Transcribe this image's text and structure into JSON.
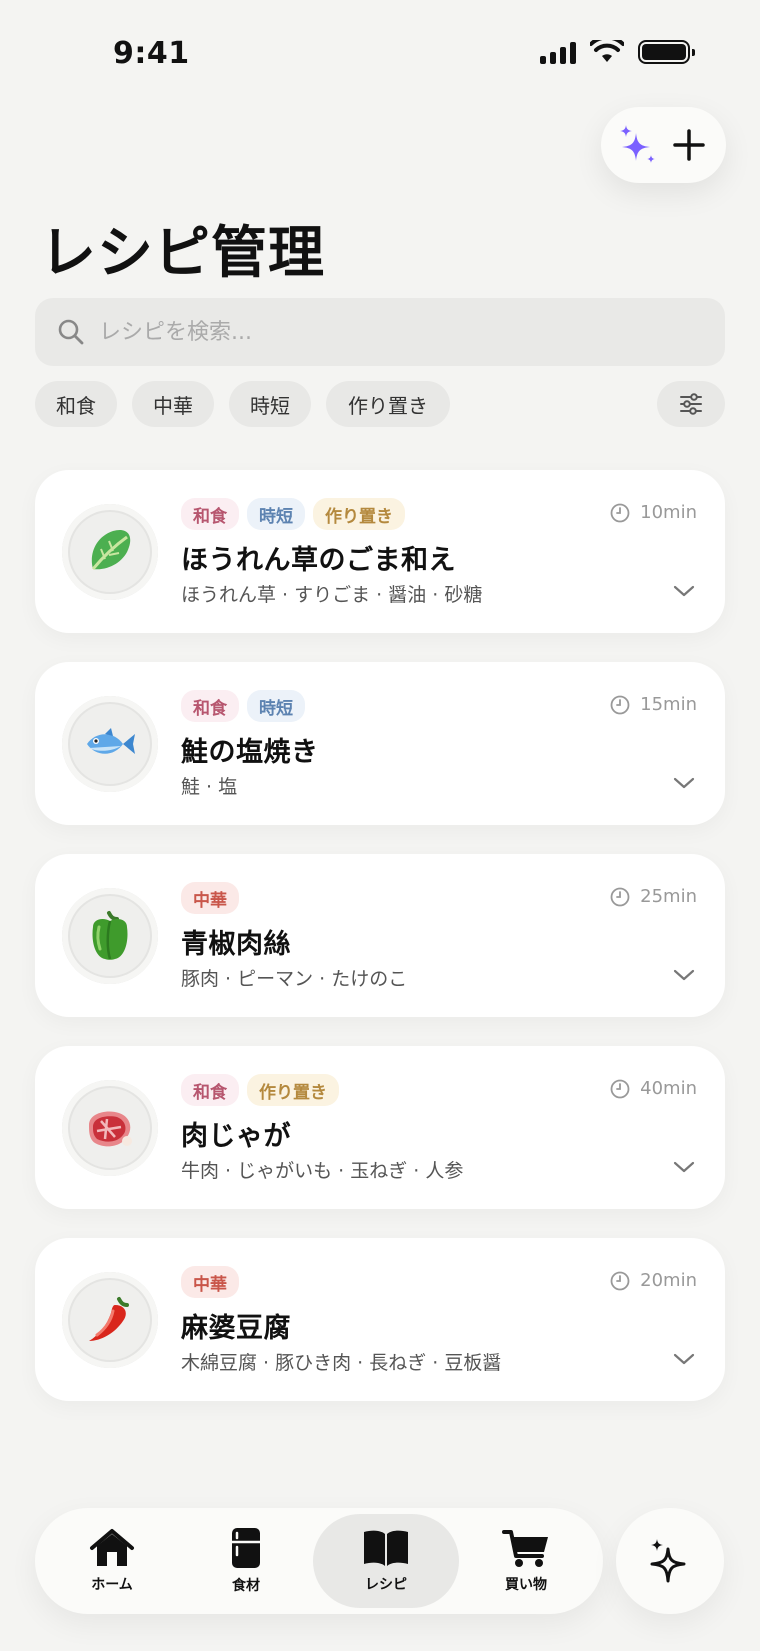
{
  "status_bar": {
    "time": "9:41"
  },
  "header": {
    "title": "レシピ管理"
  },
  "search": {
    "placeholder": "レシピを検索..."
  },
  "chips": [
    {
      "label": "和食"
    },
    {
      "label": "中華"
    },
    {
      "label": "時短"
    },
    {
      "label": "作り置き"
    }
  ],
  "recipes": [
    {
      "name": "ほうれん草のごま和え",
      "tags": [
        "和食",
        "時短",
        "作り置き"
      ],
      "time": "10min",
      "ingredients": "ほうれん草 · すりごま · 醤油 · 砂糖",
      "icon": "spinach-icon"
    },
    {
      "name": "鮭の塩焼き",
      "tags": [
        "和食",
        "時短"
      ],
      "time": "15min",
      "ingredients": "鮭 · 塩",
      "icon": "fish-icon"
    },
    {
      "name": "青椒肉絲",
      "tags": [
        "中華"
      ],
      "time": "25min",
      "ingredients": "豚肉 · ピーマン · たけのこ",
      "icon": "bell-pepper-icon"
    },
    {
      "name": "肉じゃが",
      "tags": [
        "和食",
        "作り置き"
      ],
      "time": "40min",
      "ingredients": "牛肉 · じゃがいも · 玉ねぎ · 人参",
      "icon": "steak-icon"
    },
    {
      "name": "麻婆豆腐",
      "tags": [
        "中華"
      ],
      "time": "20min",
      "ingredients": "木綿豆腐 · 豚ひき肉 · 長ねぎ · 豆板醤",
      "icon": "chili-pepper-icon"
    }
  ],
  "nav": [
    {
      "label": "ホーム",
      "icon": "home-icon"
    },
    {
      "label": "食材",
      "icon": "fridge-icon"
    },
    {
      "label": "レシピ",
      "icon": "book-icon",
      "active": true
    },
    {
      "label": "買い物",
      "icon": "cart-icon"
    }
  ],
  "colors": {
    "accent": "#7b61ff",
    "background": "#f4f4f2"
  }
}
